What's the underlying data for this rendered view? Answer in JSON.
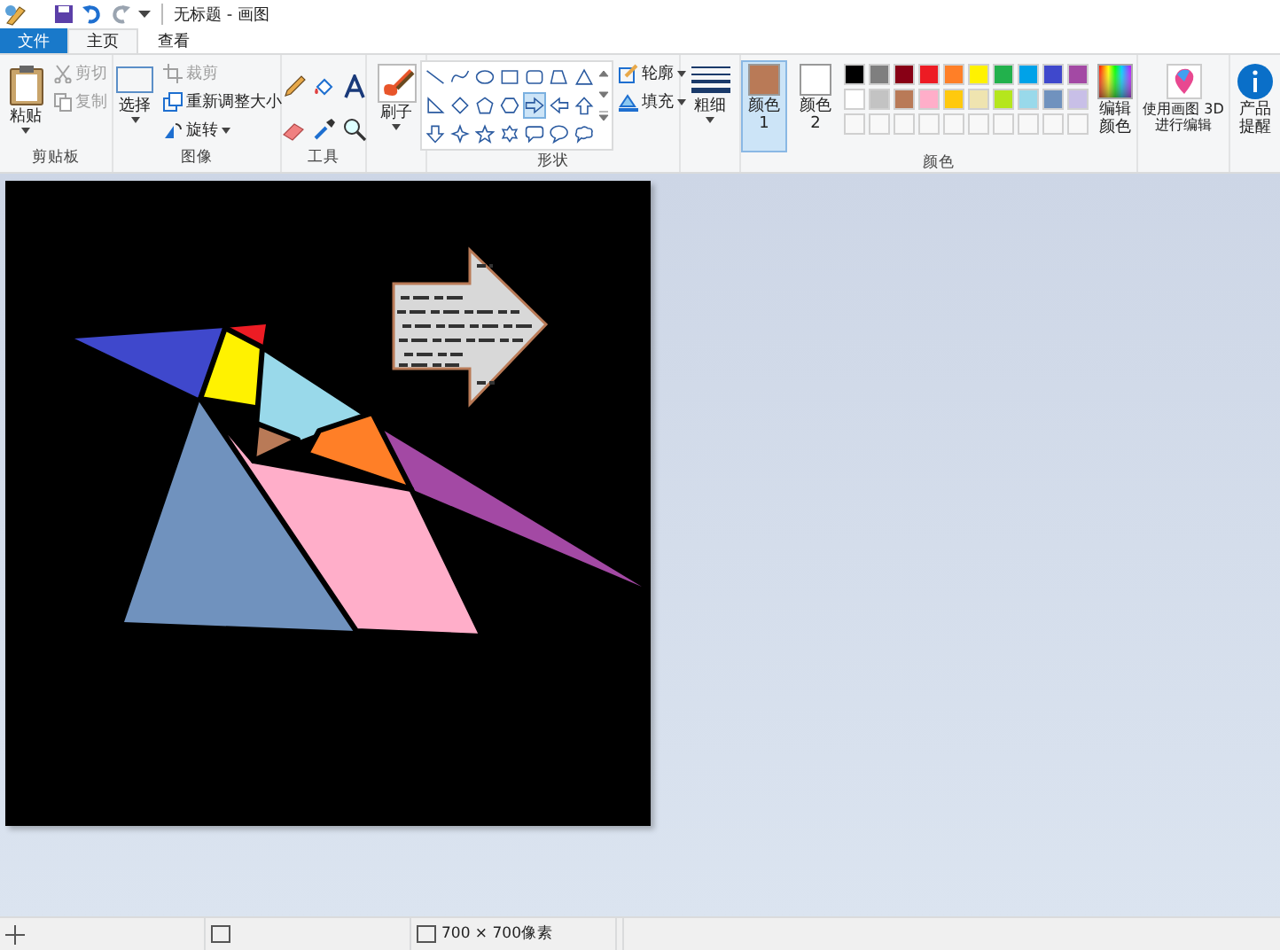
{
  "window": {
    "title": "无标题 - 画图"
  },
  "tabs": [
    {
      "label": "文件",
      "kind": "file",
      "selected": false
    },
    {
      "label": "主页",
      "kind": "tab",
      "selected": true
    },
    {
      "label": "查看",
      "kind": "tab",
      "selected": false
    }
  ],
  "clipboard": {
    "paste": "粘贴",
    "actions": [
      {
        "label": "剪切",
        "kind": "cut",
        "disabled": true
      },
      {
        "label": "复制",
        "kind": "copy",
        "disabled": true
      }
    ],
    "group_label": "剪贴板"
  },
  "image": {
    "select": "选择",
    "actions": [
      {
        "label": "裁剪",
        "kind": "crop",
        "disabled": true
      },
      {
        "label": "重新调整大小",
        "kind": "resize",
        "disabled": false
      },
      {
        "label": "旋转",
        "kind": "rotate",
        "disabled": false
      }
    ],
    "group_label": "图像"
  },
  "tools": {
    "group_label": "工具"
  },
  "brushes": {
    "label": "刷子"
  },
  "shapes": {
    "items": [
      {
        "kind": "line",
        "selected": false
      },
      {
        "kind": "curve",
        "selected": false
      },
      {
        "kind": "oval",
        "selected": false
      },
      {
        "kind": "rect",
        "selected": false
      },
      {
        "kind": "roundrect",
        "selected": false
      },
      {
        "kind": "polygon",
        "selected": false
      },
      {
        "kind": "triangle",
        "selected": false
      },
      {
        "kind": "right-triangle",
        "selected": false
      },
      {
        "kind": "diamond",
        "selected": false
      },
      {
        "kind": "pentagon",
        "selected": false
      },
      {
        "kind": "hexagon",
        "selected": false
      },
      {
        "kind": "arrow-right",
        "selected": true
      },
      {
        "kind": "arrow-left",
        "selected": false
      },
      {
        "kind": "arrow-up",
        "selected": false
      },
      {
        "kind": "arrow-down",
        "selected": false
      },
      {
        "kind": "star4",
        "selected": false
      },
      {
        "kind": "star5",
        "selected": false
      },
      {
        "kind": "star6",
        "selected": false
      },
      {
        "kind": "callout-rect",
        "selected": false
      },
      {
        "kind": "callout-oval",
        "selected": false
      },
      {
        "kind": "callout-cloud",
        "selected": false
      }
    ],
    "outline": "轮廓",
    "fill": "填充",
    "group_label": "形状"
  },
  "size": {
    "label": "粗细"
  },
  "colors": {
    "slots": [
      {
        "label": "颜色 1",
        "color": "#b97a57",
        "selected": true
      },
      {
        "label": "颜色 2",
        "color": "#ffffff",
        "selected": false
      }
    ],
    "palette": [
      {
        "color": "#000000"
      },
      {
        "color": "#7f7f7f"
      },
      {
        "color": "#880015"
      },
      {
        "color": "#ed1c24"
      },
      {
        "color": "#ff7f27"
      },
      {
        "color": "#fff200"
      },
      {
        "color": "#22b14c"
      },
      {
        "color": "#00a2e8"
      },
      {
        "color": "#3f48cc"
      },
      {
        "color": "#a349a4"
      },
      {
        "color": "#ffffff"
      },
      {
        "color": "#c3c3c3"
      },
      {
        "color": "#b97a57"
      },
      {
        "color": "#ffaec9"
      },
      {
        "color": "#ffc90e"
      },
      {
        "color": "#efe4b0"
      },
      {
        "color": "#b5e61d"
      },
      {
        "color": "#99d9ea"
      },
      {
        "color": "#7092be"
      },
      {
        "color": "#c8bfe7"
      }
    ],
    "edit": "编辑颜色",
    "group_label": "颜色"
  },
  "paint3d": "使用画图 3D 进行编辑",
  "product_alert": "产品提醒",
  "status": {
    "size": "700 × 700像素"
  }
}
